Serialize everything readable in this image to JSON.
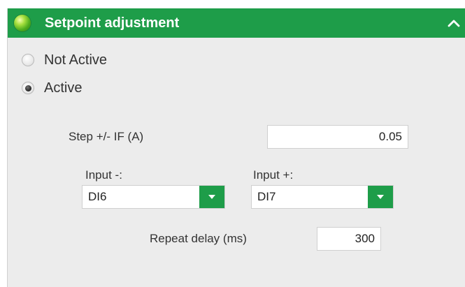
{
  "header": {
    "title": "Setpoint adjustment",
    "icon": "green-orb-icon",
    "collapse_icon": "chevron-up-icon",
    "color": "#1e9d49"
  },
  "mode": {
    "options": [
      {
        "label": "Not Active",
        "selected": false
      },
      {
        "label": "Active",
        "selected": true
      }
    ]
  },
  "step": {
    "label": "Step +/- IF (A)",
    "value": "0.05"
  },
  "input_minus": {
    "label": "Input -:",
    "value": "DI6"
  },
  "input_plus": {
    "label": "Input +:",
    "value": "DI7"
  },
  "repeat_delay": {
    "label": "Repeat delay (ms)",
    "value": "300"
  }
}
